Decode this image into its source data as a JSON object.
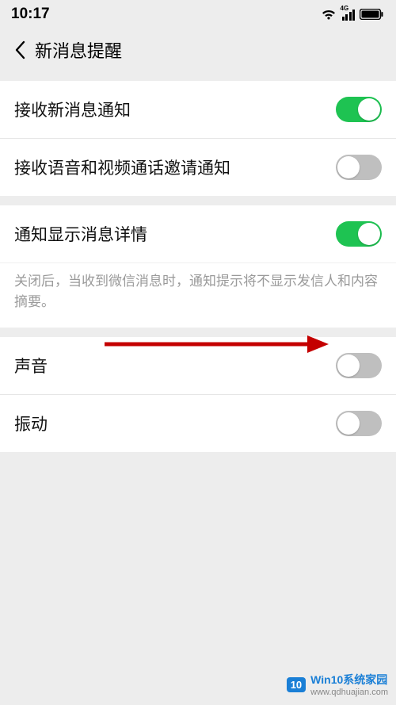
{
  "status": {
    "time": "10:17",
    "signal_label": "4G"
  },
  "nav": {
    "title": "新消息提醒"
  },
  "group1": {
    "receive_new": {
      "label": "接收新消息通知",
      "on": true
    },
    "receive_av": {
      "label": "接收语音和视频通话邀请通知",
      "on": false
    }
  },
  "group2": {
    "show_detail": {
      "label": "通知显示消息详情",
      "on": true
    },
    "hint": "关闭后，当收到微信消息时，通知提示将不显示发信人和内容摘要。"
  },
  "group3": {
    "sound": {
      "label": "声音",
      "on": false
    },
    "vibrate": {
      "label": "振动",
      "on": false
    }
  },
  "watermark": {
    "badge": "10",
    "title": "Win10系统家园",
    "url": "www.qdhuajian.com"
  }
}
